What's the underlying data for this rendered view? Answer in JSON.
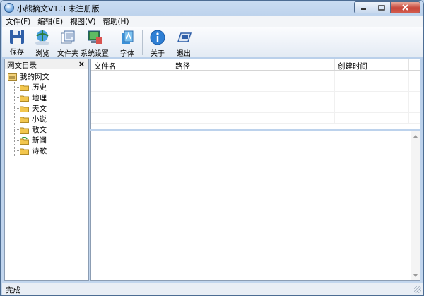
{
  "window": {
    "title": "小熊摘文V1.3 未注册版"
  },
  "menu": {
    "items": [
      "文件(F)",
      "编辑(E)",
      "视图(V)",
      "帮助(H)"
    ]
  },
  "toolbar": {
    "save": "保存",
    "browse": "浏览",
    "folder": "文件夹",
    "settings": "系统设置",
    "font": "字体",
    "about": "关于",
    "exit": "退出"
  },
  "left_panel": {
    "title": "网文目录",
    "close_glyph": "×",
    "root": "我的网文",
    "items": [
      "历史",
      "地理",
      "天文",
      "小说",
      "散文",
      "新闻",
      "诗歌"
    ]
  },
  "table": {
    "columns": [
      "文件名",
      "路径",
      "创建时间"
    ]
  },
  "status": {
    "text": "完成"
  },
  "colors": {
    "accent": "#2b6cb3",
    "folder": "#f2c64d",
    "close_button": "#c7463a"
  }
}
